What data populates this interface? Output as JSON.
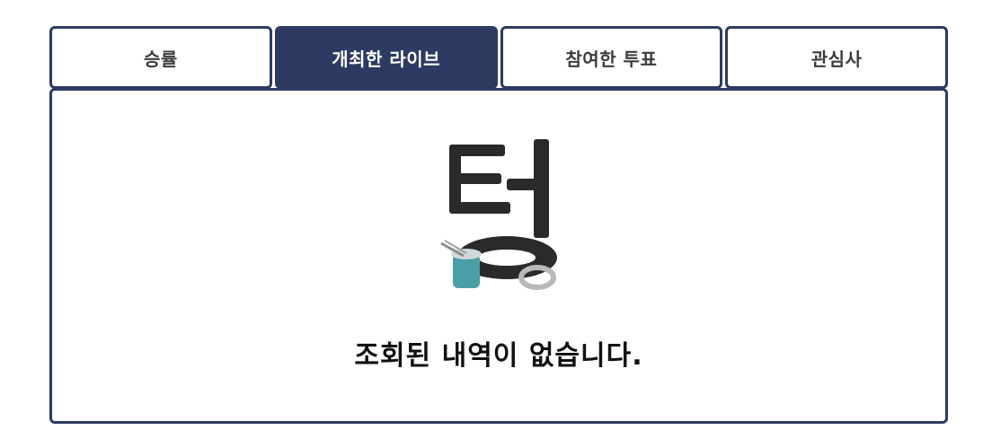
{
  "tabs": [
    {
      "label": "승률",
      "active": false
    },
    {
      "label": "개최한 라이브",
      "active": true
    },
    {
      "label": "참여한 투표",
      "active": false
    },
    {
      "label": "관심사",
      "active": false
    }
  ],
  "empty_state": {
    "illustration_text": "텅",
    "message": "조회된 내역이 없습니다."
  },
  "colors": {
    "accent": "#2d3b63",
    "text": "#111111",
    "tab_text": "#3c3c3c"
  }
}
